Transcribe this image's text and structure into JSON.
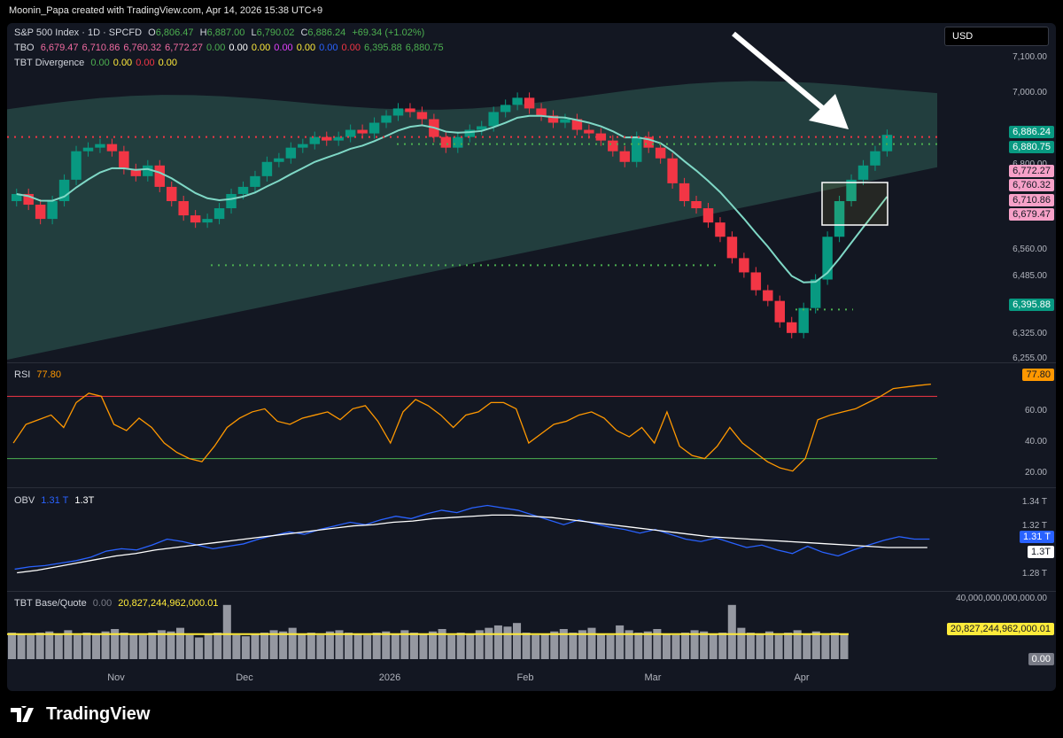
{
  "header": {
    "credit": "Moonin_Papa created with TradingView.com, Apr 14, 2026 15:38 UTC+9",
    "currency": "USD"
  },
  "main": {
    "symbol_line": "S&P 500 Index · 1D · SPCFD",
    "o_label": "O",
    "o": "6,806.47",
    "h_label": "H",
    "h": "6,887.00",
    "l_label": "L",
    "l": "6,790.02",
    "c_label": "C",
    "c": "6,886.24",
    "change": "+69.34 (+1.02%)",
    "tbo_label": "TBO",
    "tbo_values": [
      "6,679.47",
      "6,710.86",
      "6,760.32",
      "6,772.27",
      "0.00",
      "0.00",
      "0.00",
      "0.00",
      "0.00",
      "0.00",
      "0.00",
      "6,395.88",
      "6,880.75"
    ],
    "tbo_colors": [
      "#f06aa0",
      "#f06aa0",
      "#f06aa0",
      "#f06aa0",
      "#4caf50",
      "#ffffff",
      "#ffeb3b",
      "#e040fb",
      "#ffeb3b",
      "#2962ff",
      "#f23645",
      "#4caf50",
      "#4caf50"
    ],
    "divergence_label": "TBT Divergence",
    "divergence_values": [
      "0.00",
      "0.00",
      "0.00",
      "0.00"
    ],
    "divergence_colors": [
      "#4caf50",
      "#ffeb3b",
      "#f23645",
      "#ffeb3b"
    ],
    "price_tags": [
      {
        "text": "6,886.24",
        "bg": "#089981"
      },
      {
        "text": "6,880.75",
        "bg": "#089981"
      },
      {
        "text": "6,772.27",
        "bg": "#f7a1c8",
        "color": "#131722"
      },
      {
        "text": "6,760.32",
        "bg": "#f7a1c8",
        "color": "#131722"
      },
      {
        "text": "6,710.86",
        "bg": "#f7a1c8",
        "color": "#131722"
      },
      {
        "text": "6,679.47",
        "bg": "#f7a1c8",
        "color": "#131722"
      },
      {
        "text": "6,395.88",
        "bg": "#089981"
      }
    ]
  },
  "rsi": {
    "label": "RSI",
    "value": "77.80",
    "tag": "77.80"
  },
  "obv": {
    "label": "OBV",
    "value1": "1.31 T",
    "value2": "1.3T",
    "tag1": "1.31 T",
    "tag2": "1.3T"
  },
  "volume": {
    "label": "TBT Base/Quote",
    "value1": "0.00",
    "value2": "20,827,244,962,000.01",
    "tag1": "20,827,244,962,000.01",
    "tag2": "0.00"
  },
  "chart_data": {
    "type": "line",
    "title": "S&P 500 Index · 1D · SPCFD",
    "x_labels": [
      "Nov",
      "Dec",
      "2026",
      "Feb",
      "Mar",
      "Apr"
    ],
    "price_axis": [
      "7,100.00",
      "7,000.00",
      "6,800.00",
      "6,560.00",
      "6,485.00",
      "6,325.00",
      "6,255.00"
    ],
    "price_close": [
      6720,
      6690,
      6650,
      6700,
      6760,
      6840,
      6850,
      6860,
      6840,
      6790,
      6770,
      6800,
      6740,
      6700,
      6660,
      6640,
      6650,
      6680,
      6720,
      6740,
      6770,
      6810,
      6820,
      6850,
      6860,
      6880,
      6870,
      6880,
      6900,
      6890,
      6920,
      6940,
      6960,
      6950,
      6930,
      6880,
      6850,
      6880,
      6900,
      6910,
      6950,
      6970,
      6990,
      6960,
      6940,
      6920,
      6930,
      6900,
      6890,
      6870,
      6840,
      6810,
      6880,
      6850,
      6820,
      6750,
      6700,
      6680,
      6640,
      6600,
      6540,
      6500,
      6450,
      6420,
      6360,
      6330,
      6400,
      6480,
      6600,
      6700,
      6760,
      6800,
      6840,
      6886
    ],
    "rsi_axis": [
      "60.00",
      "40.00",
      "20.00"
    ],
    "rsi_levels": [
      70,
      30
    ],
    "rsi": [
      40,
      52,
      55,
      58,
      50,
      66,
      72,
      70,
      52,
      48,
      56,
      50,
      40,
      34,
      30,
      28,
      38,
      50,
      56,
      60,
      62,
      54,
      52,
      56,
      58,
      60,
      55,
      62,
      64,
      54,
      40,
      60,
      68,
      64,
      58,
      50,
      58,
      60,
      66,
      66,
      62,
      40,
      46,
      52,
      54,
      58,
      60,
      56,
      48,
      44,
      50,
      40,
      60,
      38,
      32,
      30,
      38,
      50,
      40,
      34,
      28,
      24,
      22,
      30,
      55,
      58,
      60,
      62,
      66,
      70,
      75,
      76,
      77,
      77.8
    ],
    "obv_axis": [
      "1.34 T",
      "1.32 T",
      "1.28 T"
    ],
    "obv": [
      1.285,
      1.287,
      1.288,
      1.29,
      1.292,
      1.295,
      1.3,
      1.302,
      1.301,
      1.305,
      1.31,
      1.308,
      1.305,
      1.302,
      1.304,
      1.306,
      1.31,
      1.313,
      1.316,
      1.314,
      1.318,
      1.321,
      1.324,
      1.322,
      1.326,
      1.329,
      1.327,
      1.331,
      1.334,
      1.332,
      1.336,
      1.338,
      1.336,
      1.334,
      1.33,
      1.326,
      1.322,
      1.326,
      1.323,
      1.32,
      1.318,
      1.315,
      1.318,
      1.314,
      1.31,
      1.308,
      1.311,
      1.307,
      1.303,
      1.305,
      1.301,
      1.298,
      1.304,
      1.299,
      1.296,
      1.301,
      1.305,
      1.309,
      1.312,
      1.31,
      1.31
    ],
    "obv_ma": [
      1.282,
      1.284,
      1.287,
      1.29,
      1.293,
      1.296,
      1.298,
      1.301,
      1.303,
      1.305,
      1.307,
      1.309,
      1.311,
      1.313,
      1.315,
      1.317,
      1.319,
      1.321,
      1.322,
      1.324,
      1.325,
      1.327,
      1.328,
      1.329,
      1.33,
      1.33,
      1.329,
      1.328,
      1.326,
      1.324,
      1.322,
      1.32,
      1.318,
      1.316,
      1.314,
      1.312,
      1.311,
      1.31,
      1.309,
      1.308,
      1.307,
      1.306,
      1.305,
      1.304,
      1.303,
      1.303,
      1.303
    ],
    "volume_axis": [
      "40,000,000,000,000.00"
    ],
    "volume": [
      22,
      21,
      20,
      22,
      23,
      21,
      24,
      20,
      22,
      21,
      23,
      25,
      22,
      21,
      20,
      22,
      24,
      23,
      26,
      20,
      18,
      21,
      22,
      45,
      20,
      19,
      21,
      22,
      24,
      23,
      26,
      21,
      22,
      20,
      23,
      24,
      22,
      21,
      20,
      22,
      23,
      21,
      24,
      22,
      21,
      23,
      25,
      20,
      22,
      21,
      24,
      26,
      28,
      27,
      30,
      22,
      20,
      21,
      23,
      25,
      22,
      24,
      26,
      21,
      20,
      28,
      24,
      22,
      23,
      25,
      21,
      20,
      22,
      24,
      23,
      21,
      22,
      45,
      26,
      22,
      21,
      23,
      20,
      22,
      24,
      21,
      23,
      20,
      22,
      21
    ],
    "volume_ma": 20.8
  }
}
